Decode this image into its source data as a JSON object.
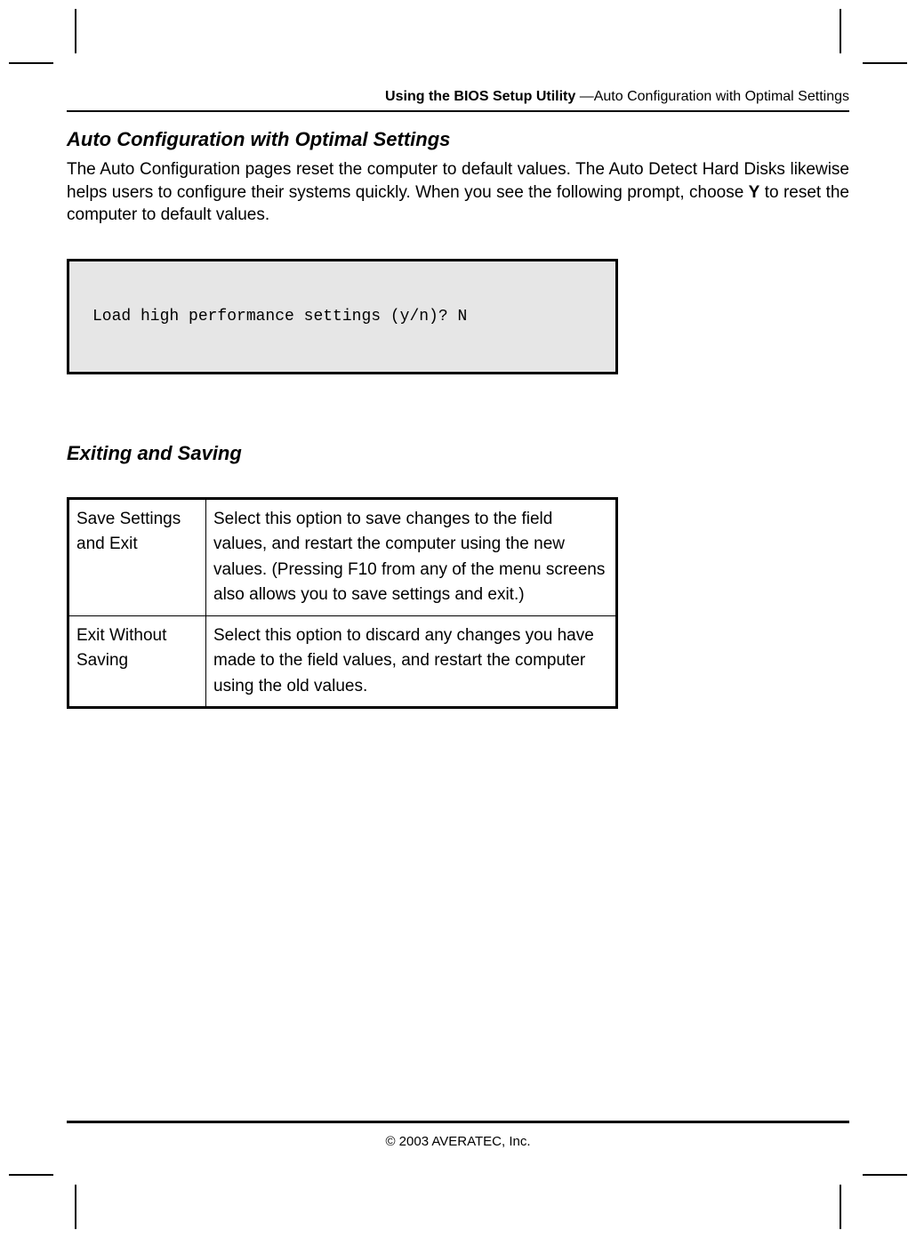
{
  "header": {
    "bold": "Using the BIOS Setup Utility ",
    "rest": "—Auto Configuration with Optimal Settings"
  },
  "section1": {
    "heading": "Auto Configuration with Optimal Settings",
    "para_pre": "The Auto Configuration pages reset the computer to default values. The Auto Detect Hard Disks likewise helps users to configure their systems quickly. When you see the following prompt, choose ",
    "para_bold": "Y",
    "para_post": " to reset the computer to default values.",
    "prompt": "Load high performance settings (y/n)? N"
  },
  "section2": {
    "heading": "Exiting and Saving",
    "rows": [
      {
        "label": "Save Settings and Exit",
        "desc": "Select this option to save changes to the field values, and restart the computer using the new values. (Pressing F10 from any of the menu screens also allows you to save settings and exit.)"
      },
      {
        "label": "Exit Without Saving",
        "desc": "Select this option to discard any changes you have made to the field values, and restart the computer using the old values."
      }
    ]
  },
  "footer": "© 2003 AVERATEC, Inc."
}
